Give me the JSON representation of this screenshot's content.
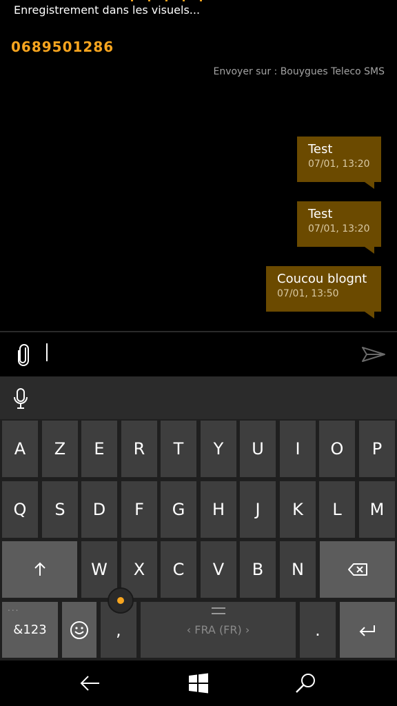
{
  "status": {
    "text": "Enregistrement dans les visuels..."
  },
  "contact": {
    "phone": "0689501286"
  },
  "send_via": "Envoyer sur : Bouygues Teleco SMS",
  "messages": [
    {
      "text": "Test",
      "time": "07/01, 13:20"
    },
    {
      "text": "Test",
      "time": "07/01, 13:20"
    },
    {
      "text": "Coucou blognt",
      "time": "07/01, 13:50"
    }
  ],
  "compose": {
    "value": ""
  },
  "keyboard": {
    "row1": [
      "A",
      "Z",
      "E",
      "R",
      "T",
      "Y",
      "U",
      "I",
      "O",
      "P"
    ],
    "row2": [
      "Q",
      "S",
      "D",
      "F",
      "G",
      "H",
      "J",
      "K",
      "L",
      "M"
    ],
    "row3": [
      "W",
      "X",
      "C",
      "V",
      "B",
      "N"
    ],
    "symbols": "&123",
    "comma": ",",
    "space": "‹ FRA (FR) ›",
    "period": ".",
    "more": "..."
  },
  "colors": {
    "accent": "#f7a51f",
    "bubble": "#6b4a00"
  },
  "icons": [
    "attach-icon",
    "send-icon",
    "microphone-icon",
    "shift-icon",
    "backspace-icon",
    "emoji-icon",
    "enter-icon",
    "back-icon",
    "windows-icon",
    "search-icon"
  ]
}
